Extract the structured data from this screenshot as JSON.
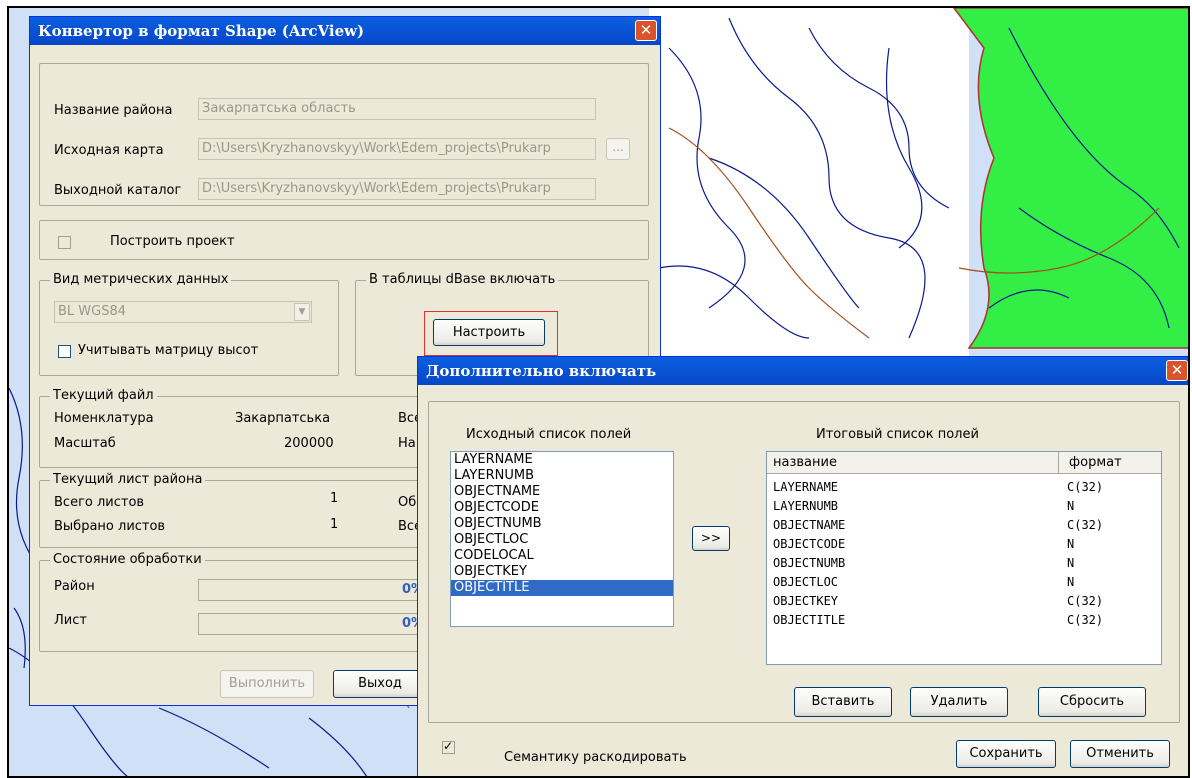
{
  "converter": {
    "title": "Конвертор в формат Shape (ArcView)",
    "close_symbol": "✕",
    "region_label": "Название района",
    "region_value": "Закарпатська область",
    "source_map_label": "Исходная карта",
    "source_map_value": "D:\\Users\\Kryzhanovskyy\\Work\\Edem_projects\\Prukarp",
    "browse_label": "...",
    "output_dir_label": "Выходной каталог",
    "output_dir_value": "D:\\Users\\Kryzhanovskyy\\Work\\Edem_projects\\Prukarp",
    "build_project_label": "Построить проект",
    "metric_group_label": "Вид метрических данных",
    "metric_select_value": "BL WGS84",
    "height_matrix_label": "Учитывать матрицу высот",
    "dbase_group_label": "В таблицы dBase включать",
    "configure_button": "Настроить",
    "current_file": {
      "group_label": "Текущий файл",
      "nomenclature_label": "Номенклатура",
      "nomenclature_value": "Закарпатська",
      "right_col_1": "Все",
      "scale_label": "Масштаб",
      "scale_value": "200000",
      "right_col_2": "На"
    },
    "current_sheet": {
      "group_label": "Текущий лист района",
      "total_label": "Всего листов",
      "total_value": "1",
      "right_col_1": "Об",
      "selected_label": "Выбрано листов",
      "selected_value": "1",
      "right_col_2": "Все"
    },
    "processing": {
      "group_label": "Состояние обработки",
      "region_label": "Район",
      "region_progress": "0%",
      "sheet_label": "Лист",
      "sheet_progress": "0%"
    },
    "run_button": "Выполнить",
    "exit_button": "Выход"
  },
  "extra": {
    "title": "Дополнительно включать",
    "close_symbol": "✕",
    "source_list_label": "Исходный список полей",
    "source_fields": [
      "LAYERNAME",
      "LAYERNUMB",
      "OBJECTNAME",
      "OBJECTCODE",
      "OBJECTNUMB",
      "OBJECTLOC",
      "CODELOCAL",
      "OBJECTKEY",
      "OBJECTITLE"
    ],
    "selected_field": "OBJECTITLE",
    "move_button": ">>",
    "result_list_label": "Итоговый список полей",
    "col_name": "название",
    "col_format": "формат",
    "result_rows": [
      {
        "name": "LAYERNAME",
        "format": "C(32)"
      },
      {
        "name": "LAYERNUMB",
        "format": "N"
      },
      {
        "name": "OBJECTNAME",
        "format": "C(32)"
      },
      {
        "name": "OBJECTCODE",
        "format": "N"
      },
      {
        "name": "OBJECTNUMB",
        "format": "N"
      },
      {
        "name": "OBJECTLOC",
        "format": "N"
      },
      {
        "name": "OBJECTKEY",
        "format": "C(32)"
      },
      {
        "name": "OBJECTITLE",
        "format": "C(32)"
      }
    ],
    "insert_button": "Вставить",
    "delete_button": "Удалить",
    "reset_button": "Сбросить",
    "decode_semantics_label": "Семантику раскодировать",
    "decode_checked": true,
    "check_symbol": "✓",
    "save_button": "Сохранить",
    "cancel_button": "Отменить"
  },
  "colors": {
    "map_water": "#cfe0f7",
    "map_land_green": "#33ee44",
    "river": "#0a1a8a",
    "highlight": "#e03030"
  }
}
